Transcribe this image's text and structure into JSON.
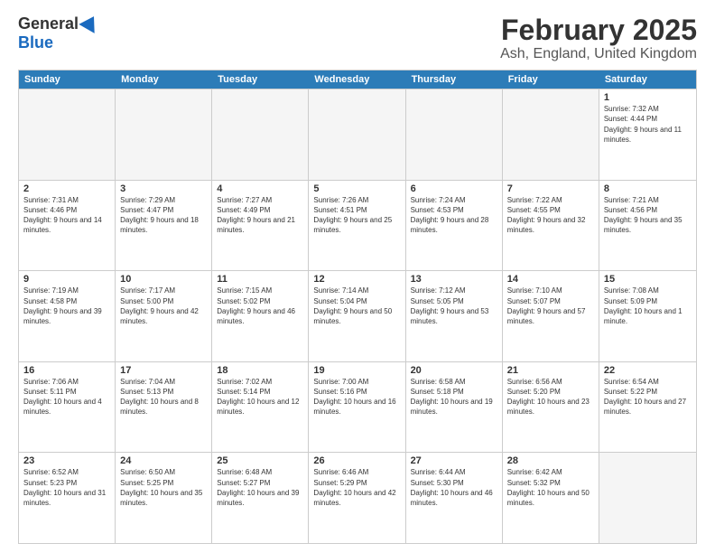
{
  "logo": {
    "general": "General",
    "blue": "Blue"
  },
  "title": "February 2025",
  "subtitle": "Ash, England, United Kingdom",
  "days_of_week": [
    "Sunday",
    "Monday",
    "Tuesday",
    "Wednesday",
    "Thursday",
    "Friday",
    "Saturday"
  ],
  "weeks": [
    [
      {
        "day": "",
        "info": "",
        "empty": true
      },
      {
        "day": "",
        "info": "",
        "empty": true
      },
      {
        "day": "",
        "info": "",
        "empty": true
      },
      {
        "day": "",
        "info": "",
        "empty": true
      },
      {
        "day": "",
        "info": "",
        "empty": true
      },
      {
        "day": "",
        "info": "",
        "empty": true
      },
      {
        "day": "1",
        "info": "Sunrise: 7:32 AM\nSunset: 4:44 PM\nDaylight: 9 hours and 11 minutes.",
        "empty": false
      }
    ],
    [
      {
        "day": "2",
        "info": "Sunrise: 7:31 AM\nSunset: 4:46 PM\nDaylight: 9 hours and 14 minutes.",
        "empty": false
      },
      {
        "day": "3",
        "info": "Sunrise: 7:29 AM\nSunset: 4:47 PM\nDaylight: 9 hours and 18 minutes.",
        "empty": false
      },
      {
        "day": "4",
        "info": "Sunrise: 7:27 AM\nSunset: 4:49 PM\nDaylight: 9 hours and 21 minutes.",
        "empty": false
      },
      {
        "day": "5",
        "info": "Sunrise: 7:26 AM\nSunset: 4:51 PM\nDaylight: 9 hours and 25 minutes.",
        "empty": false
      },
      {
        "day": "6",
        "info": "Sunrise: 7:24 AM\nSunset: 4:53 PM\nDaylight: 9 hours and 28 minutes.",
        "empty": false
      },
      {
        "day": "7",
        "info": "Sunrise: 7:22 AM\nSunset: 4:55 PM\nDaylight: 9 hours and 32 minutes.",
        "empty": false
      },
      {
        "day": "8",
        "info": "Sunrise: 7:21 AM\nSunset: 4:56 PM\nDaylight: 9 hours and 35 minutes.",
        "empty": false
      }
    ],
    [
      {
        "day": "9",
        "info": "Sunrise: 7:19 AM\nSunset: 4:58 PM\nDaylight: 9 hours and 39 minutes.",
        "empty": false
      },
      {
        "day": "10",
        "info": "Sunrise: 7:17 AM\nSunset: 5:00 PM\nDaylight: 9 hours and 42 minutes.",
        "empty": false
      },
      {
        "day": "11",
        "info": "Sunrise: 7:15 AM\nSunset: 5:02 PM\nDaylight: 9 hours and 46 minutes.",
        "empty": false
      },
      {
        "day": "12",
        "info": "Sunrise: 7:14 AM\nSunset: 5:04 PM\nDaylight: 9 hours and 50 minutes.",
        "empty": false
      },
      {
        "day": "13",
        "info": "Sunrise: 7:12 AM\nSunset: 5:05 PM\nDaylight: 9 hours and 53 minutes.",
        "empty": false
      },
      {
        "day": "14",
        "info": "Sunrise: 7:10 AM\nSunset: 5:07 PM\nDaylight: 9 hours and 57 minutes.",
        "empty": false
      },
      {
        "day": "15",
        "info": "Sunrise: 7:08 AM\nSunset: 5:09 PM\nDaylight: 10 hours and 1 minute.",
        "empty": false
      }
    ],
    [
      {
        "day": "16",
        "info": "Sunrise: 7:06 AM\nSunset: 5:11 PM\nDaylight: 10 hours and 4 minutes.",
        "empty": false
      },
      {
        "day": "17",
        "info": "Sunrise: 7:04 AM\nSunset: 5:13 PM\nDaylight: 10 hours and 8 minutes.",
        "empty": false
      },
      {
        "day": "18",
        "info": "Sunrise: 7:02 AM\nSunset: 5:14 PM\nDaylight: 10 hours and 12 minutes.",
        "empty": false
      },
      {
        "day": "19",
        "info": "Sunrise: 7:00 AM\nSunset: 5:16 PM\nDaylight: 10 hours and 16 minutes.",
        "empty": false
      },
      {
        "day": "20",
        "info": "Sunrise: 6:58 AM\nSunset: 5:18 PM\nDaylight: 10 hours and 19 minutes.",
        "empty": false
      },
      {
        "day": "21",
        "info": "Sunrise: 6:56 AM\nSunset: 5:20 PM\nDaylight: 10 hours and 23 minutes.",
        "empty": false
      },
      {
        "day": "22",
        "info": "Sunrise: 6:54 AM\nSunset: 5:22 PM\nDaylight: 10 hours and 27 minutes.",
        "empty": false
      }
    ],
    [
      {
        "day": "23",
        "info": "Sunrise: 6:52 AM\nSunset: 5:23 PM\nDaylight: 10 hours and 31 minutes.",
        "empty": false
      },
      {
        "day": "24",
        "info": "Sunrise: 6:50 AM\nSunset: 5:25 PM\nDaylight: 10 hours and 35 minutes.",
        "empty": false
      },
      {
        "day": "25",
        "info": "Sunrise: 6:48 AM\nSunset: 5:27 PM\nDaylight: 10 hours and 39 minutes.",
        "empty": false
      },
      {
        "day": "26",
        "info": "Sunrise: 6:46 AM\nSunset: 5:29 PM\nDaylight: 10 hours and 42 minutes.",
        "empty": false
      },
      {
        "day": "27",
        "info": "Sunrise: 6:44 AM\nSunset: 5:30 PM\nDaylight: 10 hours and 46 minutes.",
        "empty": false
      },
      {
        "day": "28",
        "info": "Sunrise: 6:42 AM\nSunset: 5:32 PM\nDaylight: 10 hours and 50 minutes.",
        "empty": false
      },
      {
        "day": "",
        "info": "",
        "empty": true
      }
    ]
  ]
}
